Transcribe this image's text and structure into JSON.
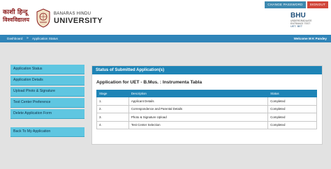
{
  "top_buttons": {
    "change_password": "CHANGE PASSWORD",
    "signout": "SIGNOUT"
  },
  "header": {
    "hindi_line1": "काशी हिन्दू",
    "hindi_line2": "विश्वविद्यालय",
    "uni_line1": "BANARAS HINDU",
    "uni_line2": "UNIVERSITY",
    "right_logo": "BHU",
    "right_logo_sub": "UNDERGRADUATE ENTRANCE TEST",
    "right_logo_sub2": "UET- BET"
  },
  "nav": {
    "home": "Dashboard",
    "separator": "»",
    "current": "Application Status",
    "welcome": "Welcome M K Pandey"
  },
  "sidebar": {
    "items": [
      {
        "label": "Application Status"
      },
      {
        "label": "Application Details"
      },
      {
        "label": "Upload Photo & Signature"
      },
      {
        "label": "Test Center Preference"
      },
      {
        "label": "Delete Application Form"
      }
    ],
    "back_label": "Back To My Application"
  },
  "panel": {
    "title": "Status of Submitted Application(s)",
    "app_title": "Application for UET - B.Mus. : Instrumenta Tabla",
    "columns": [
      "Stage",
      "Description",
      "Status"
    ],
    "rows": [
      {
        "stage": "1.",
        "description": "Applicant Details",
        "status": "Completed"
      },
      {
        "stage": "2.",
        "description": "Correspondence and Parental Details",
        "status": "Completed"
      },
      {
        "stage": "3.",
        "description": "Photo & Signature Upload",
        "status": "Completed"
      },
      {
        "stage": "4.",
        "description": "Test Center Selection",
        "status": "Completed"
      }
    ]
  },
  "colors": {
    "nav_blue": "#2f84b8",
    "panel_blue": "#1e84b6",
    "sidebar_cyan": "#5fc6e1",
    "signout_red": "#d1473b",
    "page_bg": "#e2e2e2"
  }
}
